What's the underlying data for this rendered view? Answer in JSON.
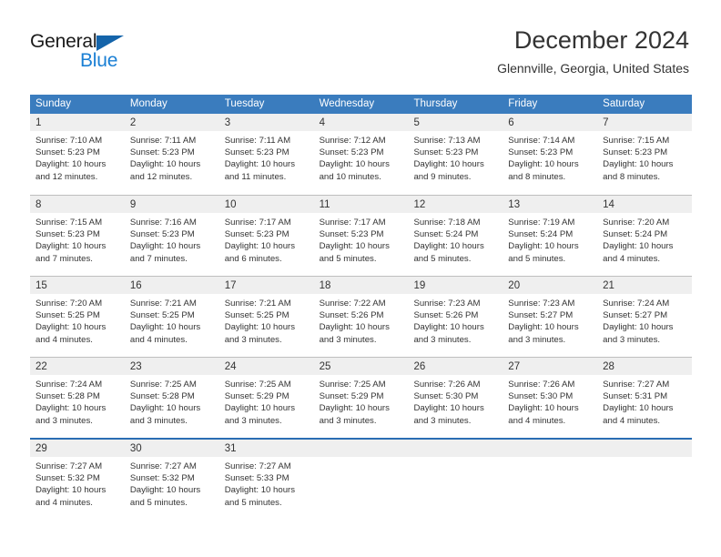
{
  "logo": {
    "word_top": "General",
    "word_bottom": "Blue",
    "triangle_icon": "blue-triangle-icon",
    "color_dark": "#1a1a1a",
    "color_blue": "#1a7fd4",
    "triangle_color": "#1464aa"
  },
  "header": {
    "title": "December 2024",
    "subtitle": "Glennville, Georgia, United States"
  },
  "colors": {
    "header_row_bg": "#3a7cbe",
    "header_row_text": "#ffffff",
    "daynum_band_bg": "#efefef",
    "row_divider": "#bfbfbf",
    "last_row_border": "#2a6db3",
    "body_text": "#333333"
  },
  "weekdays": [
    "Sunday",
    "Monday",
    "Tuesday",
    "Wednesday",
    "Thursday",
    "Friday",
    "Saturday"
  ],
  "weeks": [
    [
      {
        "day": "1",
        "sunrise": "Sunrise: 7:10 AM",
        "sunset": "Sunset: 5:23 PM",
        "daylight1": "Daylight: 10 hours",
        "daylight2": "and 12 minutes."
      },
      {
        "day": "2",
        "sunrise": "Sunrise: 7:11 AM",
        "sunset": "Sunset: 5:23 PM",
        "daylight1": "Daylight: 10 hours",
        "daylight2": "and 12 minutes."
      },
      {
        "day": "3",
        "sunrise": "Sunrise: 7:11 AM",
        "sunset": "Sunset: 5:23 PM",
        "daylight1": "Daylight: 10 hours",
        "daylight2": "and 11 minutes."
      },
      {
        "day": "4",
        "sunrise": "Sunrise: 7:12 AM",
        "sunset": "Sunset: 5:23 PM",
        "daylight1": "Daylight: 10 hours",
        "daylight2": "and 10 minutes."
      },
      {
        "day": "5",
        "sunrise": "Sunrise: 7:13 AM",
        "sunset": "Sunset: 5:23 PM",
        "daylight1": "Daylight: 10 hours",
        "daylight2": "and 9 minutes."
      },
      {
        "day": "6",
        "sunrise": "Sunrise: 7:14 AM",
        "sunset": "Sunset: 5:23 PM",
        "daylight1": "Daylight: 10 hours",
        "daylight2": "and 8 minutes."
      },
      {
        "day": "7",
        "sunrise": "Sunrise: 7:15 AM",
        "sunset": "Sunset: 5:23 PM",
        "daylight1": "Daylight: 10 hours",
        "daylight2": "and 8 minutes."
      }
    ],
    [
      {
        "day": "8",
        "sunrise": "Sunrise: 7:15 AM",
        "sunset": "Sunset: 5:23 PM",
        "daylight1": "Daylight: 10 hours",
        "daylight2": "and 7 minutes."
      },
      {
        "day": "9",
        "sunrise": "Sunrise: 7:16 AM",
        "sunset": "Sunset: 5:23 PM",
        "daylight1": "Daylight: 10 hours",
        "daylight2": "and 7 minutes."
      },
      {
        "day": "10",
        "sunrise": "Sunrise: 7:17 AM",
        "sunset": "Sunset: 5:23 PM",
        "daylight1": "Daylight: 10 hours",
        "daylight2": "and 6 minutes."
      },
      {
        "day": "11",
        "sunrise": "Sunrise: 7:17 AM",
        "sunset": "Sunset: 5:23 PM",
        "daylight1": "Daylight: 10 hours",
        "daylight2": "and 5 minutes."
      },
      {
        "day": "12",
        "sunrise": "Sunrise: 7:18 AM",
        "sunset": "Sunset: 5:24 PM",
        "daylight1": "Daylight: 10 hours",
        "daylight2": "and 5 minutes."
      },
      {
        "day": "13",
        "sunrise": "Sunrise: 7:19 AM",
        "sunset": "Sunset: 5:24 PM",
        "daylight1": "Daylight: 10 hours",
        "daylight2": "and 5 minutes."
      },
      {
        "day": "14",
        "sunrise": "Sunrise: 7:20 AM",
        "sunset": "Sunset: 5:24 PM",
        "daylight1": "Daylight: 10 hours",
        "daylight2": "and 4 minutes."
      }
    ],
    [
      {
        "day": "15",
        "sunrise": "Sunrise: 7:20 AM",
        "sunset": "Sunset: 5:25 PM",
        "daylight1": "Daylight: 10 hours",
        "daylight2": "and 4 minutes."
      },
      {
        "day": "16",
        "sunrise": "Sunrise: 7:21 AM",
        "sunset": "Sunset: 5:25 PM",
        "daylight1": "Daylight: 10 hours",
        "daylight2": "and 4 minutes."
      },
      {
        "day": "17",
        "sunrise": "Sunrise: 7:21 AM",
        "sunset": "Sunset: 5:25 PM",
        "daylight1": "Daylight: 10 hours",
        "daylight2": "and 3 minutes."
      },
      {
        "day": "18",
        "sunrise": "Sunrise: 7:22 AM",
        "sunset": "Sunset: 5:26 PM",
        "daylight1": "Daylight: 10 hours",
        "daylight2": "and 3 minutes."
      },
      {
        "day": "19",
        "sunrise": "Sunrise: 7:23 AM",
        "sunset": "Sunset: 5:26 PM",
        "daylight1": "Daylight: 10 hours",
        "daylight2": "and 3 minutes."
      },
      {
        "day": "20",
        "sunrise": "Sunrise: 7:23 AM",
        "sunset": "Sunset: 5:27 PM",
        "daylight1": "Daylight: 10 hours",
        "daylight2": "and 3 minutes."
      },
      {
        "day": "21",
        "sunrise": "Sunrise: 7:24 AM",
        "sunset": "Sunset: 5:27 PM",
        "daylight1": "Daylight: 10 hours",
        "daylight2": "and 3 minutes."
      }
    ],
    [
      {
        "day": "22",
        "sunrise": "Sunrise: 7:24 AM",
        "sunset": "Sunset: 5:28 PM",
        "daylight1": "Daylight: 10 hours",
        "daylight2": "and 3 minutes."
      },
      {
        "day": "23",
        "sunrise": "Sunrise: 7:25 AM",
        "sunset": "Sunset: 5:28 PM",
        "daylight1": "Daylight: 10 hours",
        "daylight2": "and 3 minutes."
      },
      {
        "day": "24",
        "sunrise": "Sunrise: 7:25 AM",
        "sunset": "Sunset: 5:29 PM",
        "daylight1": "Daylight: 10 hours",
        "daylight2": "and 3 minutes."
      },
      {
        "day": "25",
        "sunrise": "Sunrise: 7:25 AM",
        "sunset": "Sunset: 5:29 PM",
        "daylight1": "Daylight: 10 hours",
        "daylight2": "and 3 minutes."
      },
      {
        "day": "26",
        "sunrise": "Sunrise: 7:26 AM",
        "sunset": "Sunset: 5:30 PM",
        "daylight1": "Daylight: 10 hours",
        "daylight2": "and 3 minutes."
      },
      {
        "day": "27",
        "sunrise": "Sunrise: 7:26 AM",
        "sunset": "Sunset: 5:30 PM",
        "daylight1": "Daylight: 10 hours",
        "daylight2": "and 4 minutes."
      },
      {
        "day": "28",
        "sunrise": "Sunrise: 7:27 AM",
        "sunset": "Sunset: 5:31 PM",
        "daylight1": "Daylight: 10 hours",
        "daylight2": "and 4 minutes."
      }
    ],
    [
      {
        "day": "29",
        "sunrise": "Sunrise: 7:27 AM",
        "sunset": "Sunset: 5:32 PM",
        "daylight1": "Daylight: 10 hours",
        "daylight2": "and 4 minutes."
      },
      {
        "day": "30",
        "sunrise": "Sunrise: 7:27 AM",
        "sunset": "Sunset: 5:32 PM",
        "daylight1": "Daylight: 10 hours",
        "daylight2": "and 5 minutes."
      },
      {
        "day": "31",
        "sunrise": "Sunrise: 7:27 AM",
        "sunset": "Sunset: 5:33 PM",
        "daylight1": "Daylight: 10 hours",
        "daylight2": "and 5 minutes."
      },
      {
        "day": "",
        "sunrise": "",
        "sunset": "",
        "daylight1": "",
        "daylight2": ""
      },
      {
        "day": "",
        "sunrise": "",
        "sunset": "",
        "daylight1": "",
        "daylight2": ""
      },
      {
        "day": "",
        "sunrise": "",
        "sunset": "",
        "daylight1": "",
        "daylight2": ""
      },
      {
        "day": "",
        "sunrise": "",
        "sunset": "",
        "daylight1": "",
        "daylight2": ""
      }
    ]
  ]
}
